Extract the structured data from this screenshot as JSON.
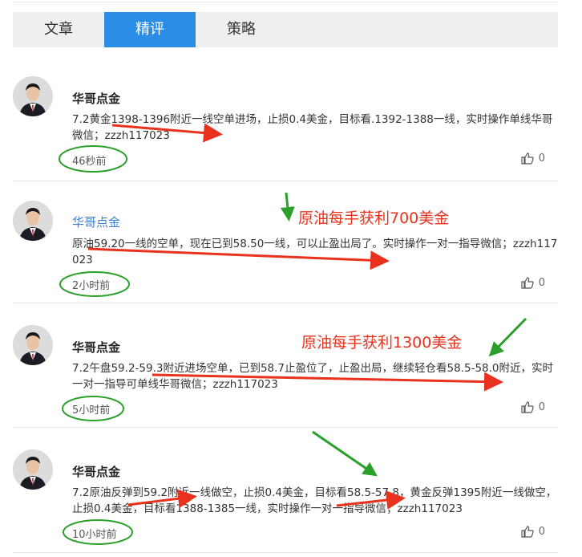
{
  "tabs": [
    {
      "label": "文章",
      "active": false
    },
    {
      "label": "精评",
      "active": true
    },
    {
      "label": "策略",
      "active": false
    }
  ],
  "accent_color": "#2a8ee6",
  "annotation_color": "#e8321d",
  "posts": [
    {
      "author": "华哥点金",
      "content": "7.2黄金1398-1396附近一线空单进场，止损0.4美金，目标看.1392-1388一线，实时操作单线华哥微信；zzzh117023",
      "time": "46秒前",
      "likes": "0"
    },
    {
      "author": "华哥点金",
      "content": "原油59.20一线的空单，现在已到58.50一线，可以止盈出局了。实时操作一对一指导微信；zzzh117023",
      "time": "2小时前",
      "likes": "0",
      "annotation": "原油每手获利700美金"
    },
    {
      "author": "华哥点金",
      "content": "7.2午盘59.2-59.3附近进场空单，已到58.7止盈位了，止盈出局，继续轻仓看58.5-58.0附近，实时一对一指导可单线华哥微信；zzzh117023",
      "time": "5小时前",
      "likes": "0",
      "annotation": "原油每手获利1300美金"
    },
    {
      "author": "华哥点金",
      "content": "7.2原油反弹到59.2附近一线做空，止损0.4美金，目标看58.5-57.8，黄金反弹1395附近一线做空，止损0.4美金，目标看1388-1385一线，实时操作一对一指导微信；zzzh117023",
      "time": "10小时前",
      "likes": "0"
    }
  ]
}
